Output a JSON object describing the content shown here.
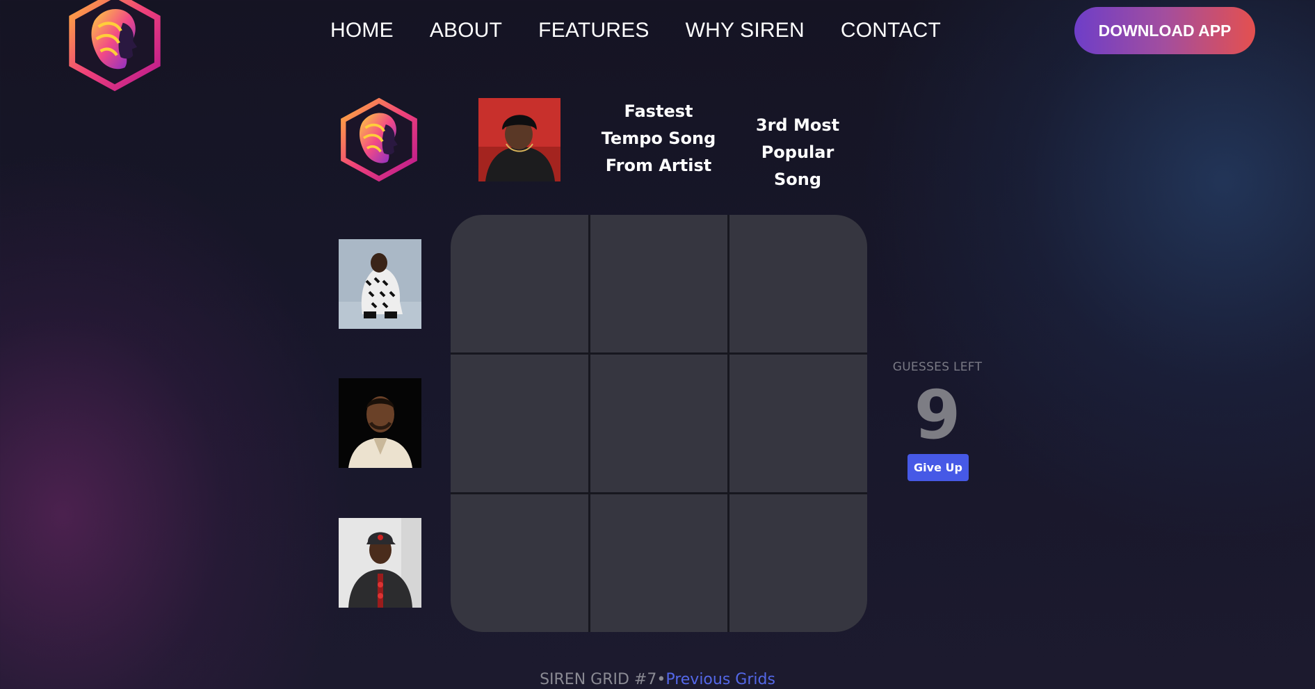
{
  "nav": {
    "logo_icon": "siren-logo-icon",
    "links": [
      "HOME",
      "ABOUT",
      "FEATURES",
      "WHY SIREN",
      "CONTACT"
    ],
    "download_label": "DOWNLOAD APP"
  },
  "grid": {
    "columns": [
      {
        "type": "artist-photo",
        "icon": "artist-photo-1"
      },
      {
        "type": "text",
        "label": "Fastest Tempo Song From Artist"
      },
      {
        "type": "text",
        "label": "3rd Most Popular Song"
      }
    ],
    "rows": [
      {
        "icon": "artist-photo-2"
      },
      {
        "icon": "artist-photo-3"
      },
      {
        "icon": "artist-photo-4"
      }
    ],
    "cells": [
      "",
      "",
      "",
      "",
      "",
      "",
      "",
      "",
      ""
    ]
  },
  "side": {
    "guesses_label": "GUESSES LEFT",
    "guesses_count": "9",
    "give_up_label": "Give Up"
  },
  "footer": {
    "title": "SIREN GRID #7",
    "separator": "•",
    "link_label": "Previous Grids"
  },
  "colors": {
    "accent_start": "#6e3ec8",
    "accent_end": "#e4504f",
    "give_up": "#4659e6",
    "link": "#5468e8",
    "cell": "#363640"
  }
}
